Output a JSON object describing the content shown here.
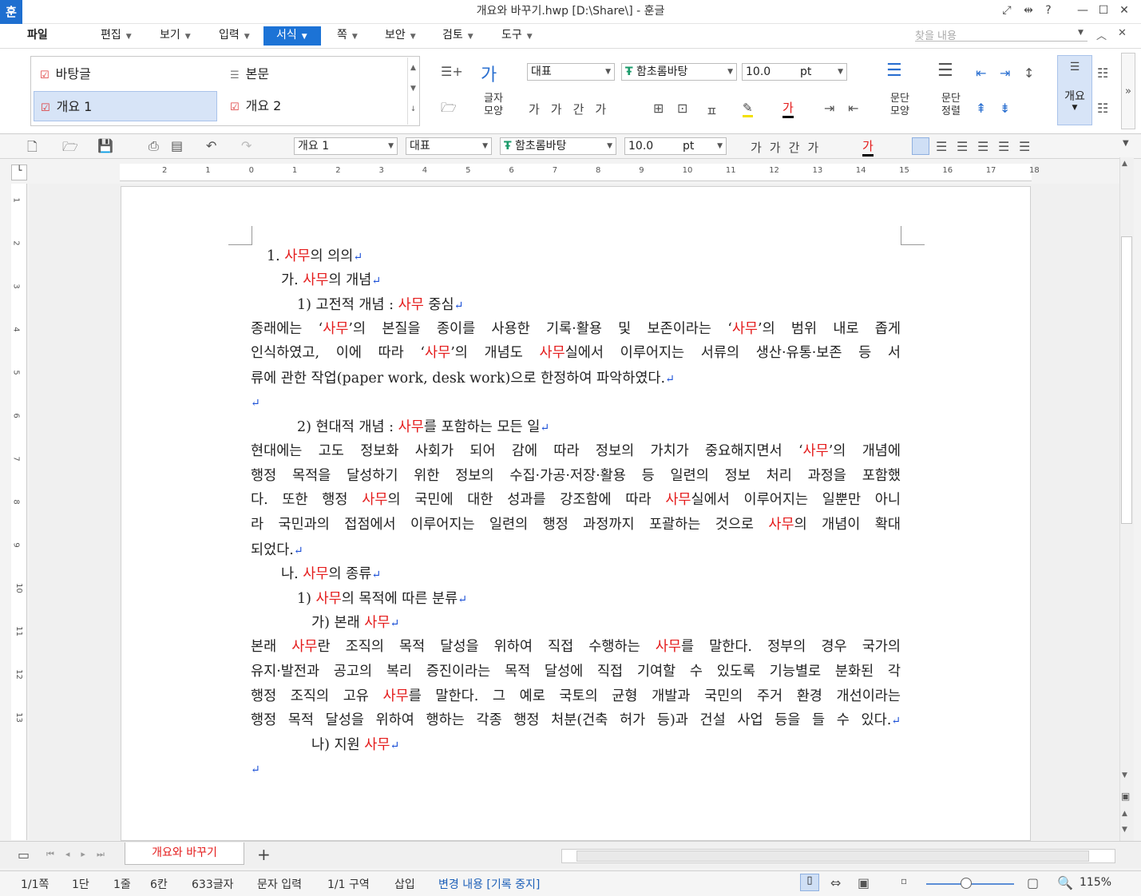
{
  "window": {
    "title": "개요와 바꾸기.hwp [D:\\Share\\] - 훈글",
    "app_icon": "훈"
  },
  "menu": [
    "파일",
    "편집",
    "보기",
    "입력",
    "서식",
    "쪽",
    "보안",
    "검토",
    "도구"
  ],
  "search": {
    "placeholder": "찾을 내용"
  },
  "ribbon": {
    "styles": [
      "바탕글",
      "본문",
      "개요 1",
      "개요 2"
    ],
    "char_shape_label": [
      "글자",
      "모양"
    ],
    "para_shape_label": [
      "문단",
      "모양"
    ],
    "para_align_label": [
      "문단",
      "정렬"
    ],
    "outline_label": "개요",
    "lang_select": "대표",
    "font": "함초롬바탕",
    "font_size": "10.0",
    "size_unit": "pt"
  },
  "toolbar2": {
    "style": "개요 1",
    "lang": "대표",
    "font": "함초롬바탕",
    "size": "10.0",
    "unit": "pt"
  },
  "ruler": {
    "ticks": [
      "2",
      "1",
      "0",
      "1",
      "2",
      "3",
      "4",
      "5",
      "6",
      "7",
      "8",
      "9",
      "10",
      "11",
      "12",
      "13",
      "14",
      "15",
      "16",
      "17",
      "18"
    ]
  },
  "vruler": {
    "ticks": [
      "1",
      "2",
      "3",
      "4",
      "5",
      "6",
      "7",
      "8",
      "9",
      "10",
      "11",
      "12",
      "13"
    ]
  },
  "document": {
    "lines": [
      [
        [
          "1. ",
          ""
        ],
        [
          "사무",
          "r"
        ],
        [
          "의 의의",
          ""
        ]
      ],
      [
        [
          "가. ",
          ""
        ],
        [
          "사무",
          "r"
        ],
        [
          "의 개념",
          ""
        ]
      ],
      [
        [
          "1) 고전적 개념 : ",
          ""
        ],
        [
          "사무",
          "r"
        ],
        [
          " 중심",
          ""
        ]
      ],
      [
        [
          "종래에는 ‘",
          ""
        ],
        [
          "사무",
          "r"
        ],
        [
          "’의 본질을 종이를 사용한 기록·활용 및 보존이라는 ‘",
          ""
        ],
        [
          "사무",
          "r"
        ],
        [
          "’의 범위 내로 좁게",
          ""
        ]
      ],
      [
        [
          "인식하였고, 이에 따라 ‘",
          ""
        ],
        [
          "사무",
          "r"
        ],
        [
          "’의 개념도 ",
          ""
        ],
        [
          "사무",
          "r"
        ],
        [
          "실에서 이루어지는 서류의 생산·유통·보존 등 서",
          ""
        ]
      ],
      [
        [
          "류에 관한 작업(paper work, desk work)으로 한정하여 파악하였다.",
          ""
        ]
      ],
      [],
      [
        [
          "2) 현대적 개념 : ",
          ""
        ],
        [
          "사무",
          "r"
        ],
        [
          "를 포함하는 모든 일",
          ""
        ]
      ],
      [
        [
          "현대에는 고도 정보화 사회가 되어 감에 따라 정보의 가치가 중요해지면서 ‘",
          ""
        ],
        [
          "사무",
          "r"
        ],
        [
          "’의 개념에",
          ""
        ]
      ],
      [
        [
          "행정 목적을 달성하기 위한 정보의 수집·가공·저장·활용 등 일련의 정보 처리 과정을 포함했",
          ""
        ]
      ],
      [
        [
          "다. 또한 행정 ",
          ""
        ],
        [
          "사무",
          "r"
        ],
        [
          "의 국민에 대한 성과를 강조함에 따라 ",
          ""
        ],
        [
          "사무",
          "r"
        ],
        [
          "실에서 이루어지는 일뿐만 아니",
          ""
        ]
      ],
      [
        [
          "라 국민과의 접점에서 이루어지는 일련의 행정 과정까지 포괄하는 것으로 ",
          ""
        ],
        [
          "사무",
          "r"
        ],
        [
          "의 개념이 확대",
          ""
        ]
      ],
      [
        [
          "되었다.",
          ""
        ]
      ],
      [
        [
          "나. ",
          ""
        ],
        [
          "사무",
          "r"
        ],
        [
          "의 종류",
          ""
        ]
      ],
      [
        [
          "1) ",
          ""
        ],
        [
          "사무",
          "r"
        ],
        [
          "의 목적에 따른 분류",
          ""
        ]
      ],
      [
        [
          "가) 본래 ",
          ""
        ],
        [
          "사무",
          "r"
        ]
      ],
      [
        [
          "본래 ",
          ""
        ],
        [
          "사무",
          "r"
        ],
        [
          "란 조직의 목적 달성을 위하여 직접 수행하는 ",
          ""
        ],
        [
          "사무",
          "r"
        ],
        [
          "를 말한다. 정부의 경우 국가의",
          ""
        ]
      ],
      [
        [
          "유지·발전과 공고의 복리 증진이라는 목적 달성에 직접 기여할 수 있도록 기능별로 분화된 각",
          ""
        ]
      ],
      [
        [
          "행정 조직의 고유 ",
          ""
        ],
        [
          "사무",
          "r"
        ],
        [
          "를 말한다. 그 예로 국토의 균형 개발과 국민의 주거 환경 개선이라는",
          ""
        ]
      ],
      [
        [
          "행정 목적 달성을 위하여 행하는 각종 행정 처분(건축 허가 등)과 건설 사업 등을 들 수 있다.",
          ""
        ]
      ],
      [
        [
          "나) 지원 ",
          ""
        ],
        [
          "사무",
          "r"
        ]
      ],
      []
    ]
  },
  "tabs": {
    "doc_tab": "개요와 바꾸기",
    "add": "+"
  },
  "status": {
    "page": "1/1쪽",
    "column": "1단",
    "line": "1줄",
    "col": "6칸",
    "chars": "633글자",
    "mode": "문자 입력",
    "section": "1/1 구역",
    "insert": "삽입",
    "track": "변경 내용 [기록 중지]",
    "zoom": "115%",
    "zoom_level": 0.45
  },
  "colors": {
    "accent": "#1c73d6",
    "highlight_word": "#e41b1b",
    "para_mark": "#1a4fd6"
  }
}
